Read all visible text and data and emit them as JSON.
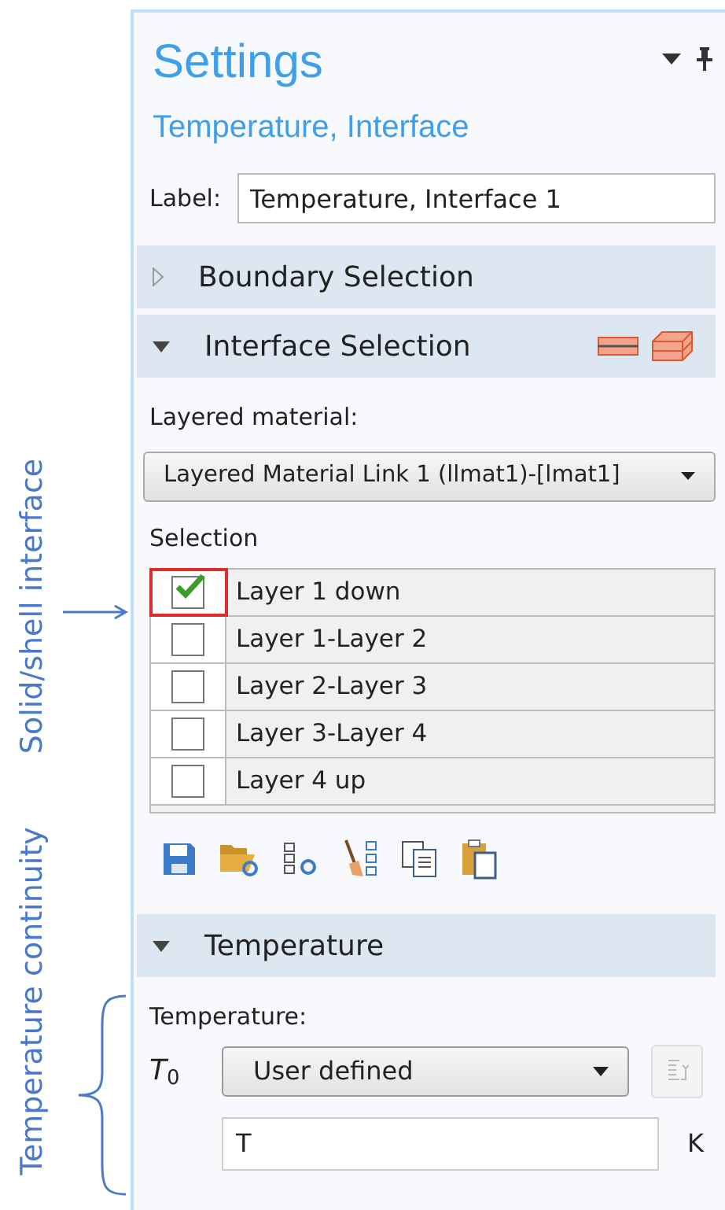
{
  "annotations": [
    {
      "kind": "arrow",
      "text": "Solid/shell interface"
    },
    {
      "kind": "brace",
      "text": "Temperature continuity"
    }
  ],
  "panel": {
    "title": "Settings",
    "subtitle": "Temperature, Interface",
    "label": {
      "caption": "Label:",
      "value": "Temperature, Interface 1"
    }
  },
  "boundary_section": {
    "title": "Boundary Selection",
    "expanded": false
  },
  "interface_section": {
    "title": "Interface Selection",
    "expanded": true,
    "layered_material": {
      "caption": "Layered material:",
      "value": "Layered Material Link 1 (llmat1)-[lmat1]"
    },
    "selection_caption": "Selection",
    "layers": [
      {
        "name": "Layer 1 down",
        "checked": true,
        "highlighted": true
      },
      {
        "name": "Layer 1-Layer 2",
        "checked": false,
        "highlighted": false
      },
      {
        "name": "Layer 2-Layer 3",
        "checked": false,
        "highlighted": false
      },
      {
        "name": "Layer 3-Layer 4",
        "checked": false,
        "highlighted": false
      },
      {
        "name": "Layer 4 up",
        "checked": false,
        "highlighted": false
      }
    ]
  },
  "temperature_section": {
    "title": "Temperature",
    "expanded": true,
    "caption": "Temperature:",
    "symbol": "T",
    "subscript": "0",
    "select_value": "User defined",
    "input_value": "T",
    "unit": "K"
  }
}
